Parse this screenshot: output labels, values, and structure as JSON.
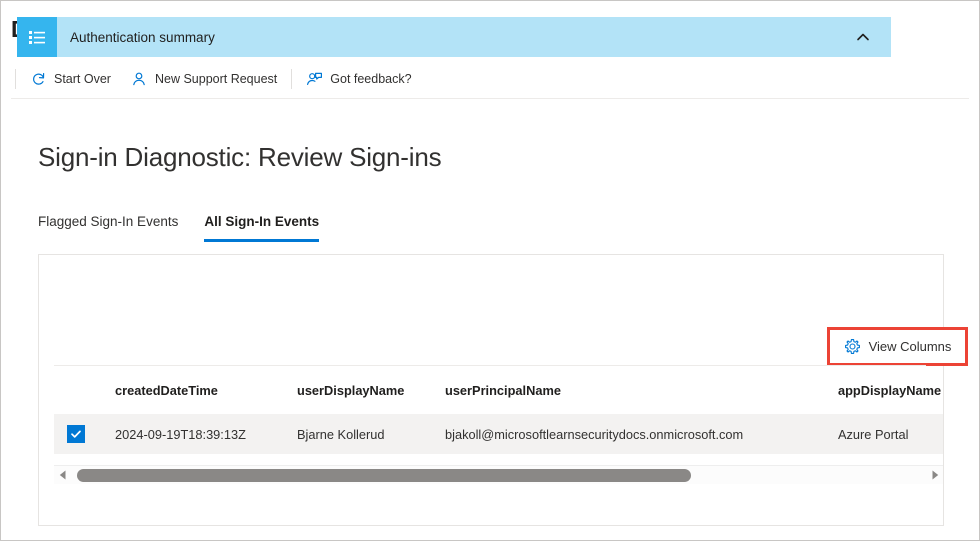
{
  "blade": {
    "title": "Diagnose and solve problems",
    "more_menu": "…"
  },
  "commandbar": {
    "buttons": [
      {
        "label": "Start Over",
        "icon": "refresh-icon"
      },
      {
        "label": "New Support Request",
        "icon": "person-icon"
      },
      {
        "label": "Got feedback?",
        "icon": "feedback-person-icon"
      }
    ]
  },
  "page": {
    "title": "Sign-in Diagnostic: Review Sign-ins"
  },
  "tabs": [
    {
      "label": "Flagged Sign-In Events",
      "active": false
    },
    {
      "label": "All Sign-In Events",
      "active": true
    }
  ],
  "accordion": {
    "title": "Authentication summary",
    "icon": "summary-list-icon",
    "chevron": "chevron-up-icon",
    "expanded": true,
    "header_bg": "#b3e3f7",
    "icon_bg": "#35b5ee"
  },
  "toolbar": {
    "view_columns_label": "View Columns",
    "view_columns_icon": "gear-icon",
    "highlight_color": "#ec4335"
  },
  "table": {
    "columns": [
      "createdDateTime",
      "userDisplayName",
      "userPrincipalName",
      "appDisplayName"
    ],
    "rows": [
      {
        "selected": true,
        "createdDateTime": "2024-09-19T18:39:13Z",
        "userDisplayName": "Bjarne Kollerud",
        "userPrincipalName": "bjakoll@microsoftlearnsecuritydocs.onmicrosoft.com",
        "appDisplayName": "Azure Portal"
      }
    ]
  },
  "scrollbar": {
    "left_arrow": "scroll-left-arrow-icon",
    "right_arrow": "scroll-right-arrow-icon",
    "thumb_position_percent": 0,
    "thumb_width_percent": 70
  },
  "colors": {
    "accent": "#0078d4",
    "text": "#323130",
    "row_bg": "#f3f2f1"
  }
}
